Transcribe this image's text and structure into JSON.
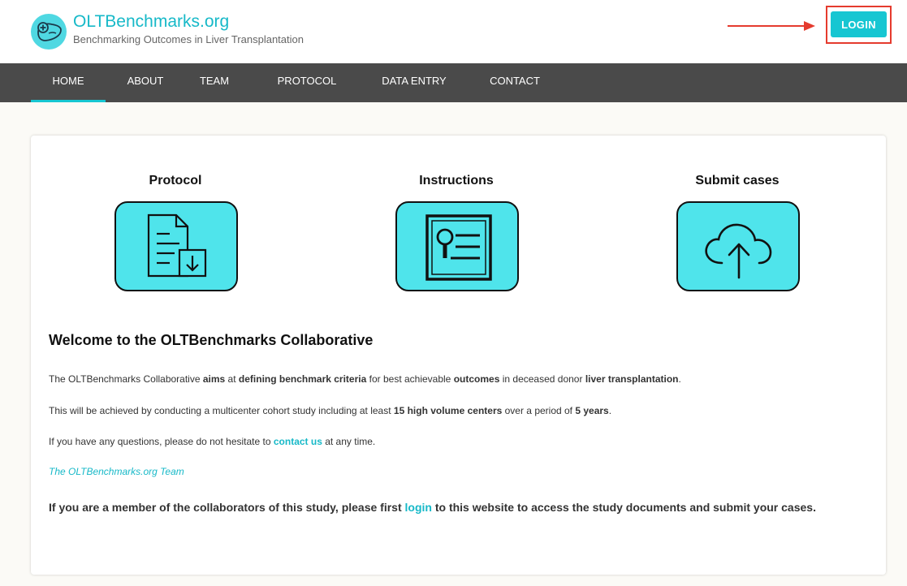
{
  "header": {
    "site_title": "OLTBenchmarks.org",
    "tagline": "Benchmarking Outcomes in Liver Transplantation",
    "login_label": "LOGIN"
  },
  "nav": {
    "items": [
      {
        "label": "HOME",
        "active": true
      },
      {
        "label": "ABOUT"
      },
      {
        "label": "TEAM"
      },
      {
        "label": "PROTOCOL"
      },
      {
        "label": "DATA ENTRY"
      },
      {
        "label": "CONTACT"
      }
    ]
  },
  "features": [
    {
      "title": "Protocol",
      "icon": "document-download-icon"
    },
    {
      "title": "Instructions",
      "icon": "id-card-search-icon"
    },
    {
      "title": "Submit cases",
      "icon": "cloud-upload-icon"
    }
  ],
  "content": {
    "welcome_title": "Welcome to the OLTBenchmarks Collaborative",
    "p1": {
      "t1": "The OLTBenchmarks Collaborative ",
      "b1": "aims",
      "t2": " at ",
      "b2": "defining benchmark criteria",
      "t3": " for best achievable ",
      "b3": "outcomes",
      "t4": " in deceased donor ",
      "b4": "liver transplantation",
      "t5": "."
    },
    "p2": {
      "t1": "This will be achieved by conducting a multicenter cohort study including at least ",
      "b1": "15 high volume centers",
      "t2": " over a period of ",
      "b2": "5 years",
      "t3": "."
    },
    "p3": {
      "t1": "If you have any questions, please do not hesitate to ",
      "link": "contact us",
      "t2": " at any time."
    },
    "signature": "The OLTBenchmarks.org Team",
    "p4": {
      "t1": "If you are a member of the collaborators of this study, please first ",
      "link": "login",
      "t2": " to this website to access the study documents and submit your cases."
    }
  },
  "colors": {
    "accent": "#17c6d2",
    "tile": "#4fe4eb",
    "nav_bg": "#4a4a4a",
    "annotation": "#e53b2e"
  }
}
